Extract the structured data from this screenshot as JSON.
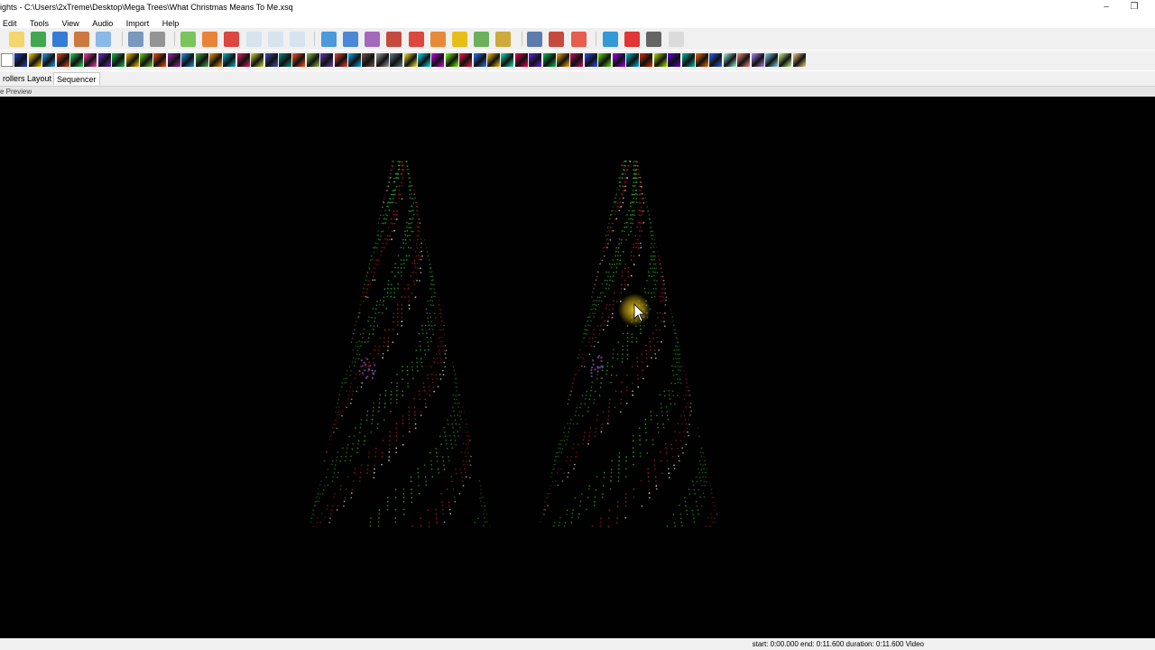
{
  "window": {
    "title": "ights - C:\\Users\\2xTreme\\Desktop\\Mega Trees\\What Christmas Means To Me.xsq",
    "minimize_glyph": "–",
    "restore_glyph": "❐"
  },
  "menu": [
    "Edit",
    "Tools",
    "View",
    "Audio",
    "Import",
    "Help"
  ],
  "tabs": [
    {
      "label": "rollers",
      "active": false
    },
    {
      "label": "Layout",
      "active": false
    },
    {
      "label": "Sequencer",
      "active": true
    }
  ],
  "preview_panel": {
    "label": "e Preview"
  },
  "status": {
    "text": "start: 0:00.000 end: 0:11.600 duration: 0:11.600 Video"
  },
  "toolbar1_icons": [
    "new-sequence-icon",
    "open-folder-icon",
    "save-icon",
    "save-as-icon",
    "render-icon",
    "timer-icon",
    "delete-icon",
    "play-icon",
    "pause-icon",
    "stop-icon",
    "first-frame-icon",
    "last-frame-icon",
    "repeat-icon",
    "settings-gear-icon",
    "grid-icon",
    "layers-icon",
    "effects-icon",
    "warning-icon",
    "home-icon",
    "align-icon",
    "tools-icon",
    "brush-icon",
    "zoom-in-icon",
    "zoom-out-icon",
    "bookmark-icon",
    "help-icon",
    "record-icon",
    "bulb-off-icon",
    "bulb-on-icon"
  ],
  "toolbar2_icons": [
    "off-effect-icon",
    "on-effect-icon",
    "bars-effect-icon",
    "butterfly-effect-icon",
    "candle-effect-icon",
    "circles-effect-icon",
    "color-wash-icon",
    "curtain-effect-icon",
    "dmx-effect-icon",
    "faces-effect-icon",
    "fan-effect-icon",
    "fire-effect-icon",
    "fireworks-effect-icon",
    "galaxy-effect-icon",
    "garlands-effect-icon",
    "glediator-effect-icon",
    "kaleidoscope-effect-icon",
    "life-effect-icon",
    "lightning-effect-icon",
    "lines-effect-icon",
    "liquid-effect-icon",
    "marquee-effect-icon",
    "meteors-effect-icon",
    "morph-effect-icon",
    "moving-head-icon",
    "music-effect-icon",
    "piano-effect-icon",
    "pictures-effect-icon",
    "pinwheel-effect-icon",
    "plasma-effect-icon",
    "ripple-effect-icon",
    "servo-effect-icon",
    "shader-effect-icon",
    "shape-effect-icon",
    "shimmer-effect-icon",
    "shockwave-effect-icon",
    "singing-face-icon",
    "snowflakes-effect-icon",
    "snowstorm-effect-icon",
    "spirals-effect-icon",
    "spirograph-effect-icon",
    "state-effect-icon",
    "strobe-effect-icon",
    "tendril-effect-icon",
    "text-effect-icon",
    "tree-effect-icon",
    "twinkle-effect-icon",
    "vu-meter-icon",
    "video-effect-icon",
    "warp-effect-icon",
    "wave-effect-icon",
    "duplicate-effect-icon",
    "sketch-effect-icon",
    "guitar-effect-icon",
    "adjust-effect-icon",
    "on-wave-effect-icon",
    "fill-effect-icon",
    "wave-w-effect-icon"
  ],
  "colors": {
    "preview_bg": "#010101",
    "tree_green": "#2fb82f",
    "tree_red": "#c81e1e",
    "tree_white": "#e8e8e8",
    "tree_purple": "#8a4fb0",
    "cursor_highlight": "#e6c619"
  }
}
